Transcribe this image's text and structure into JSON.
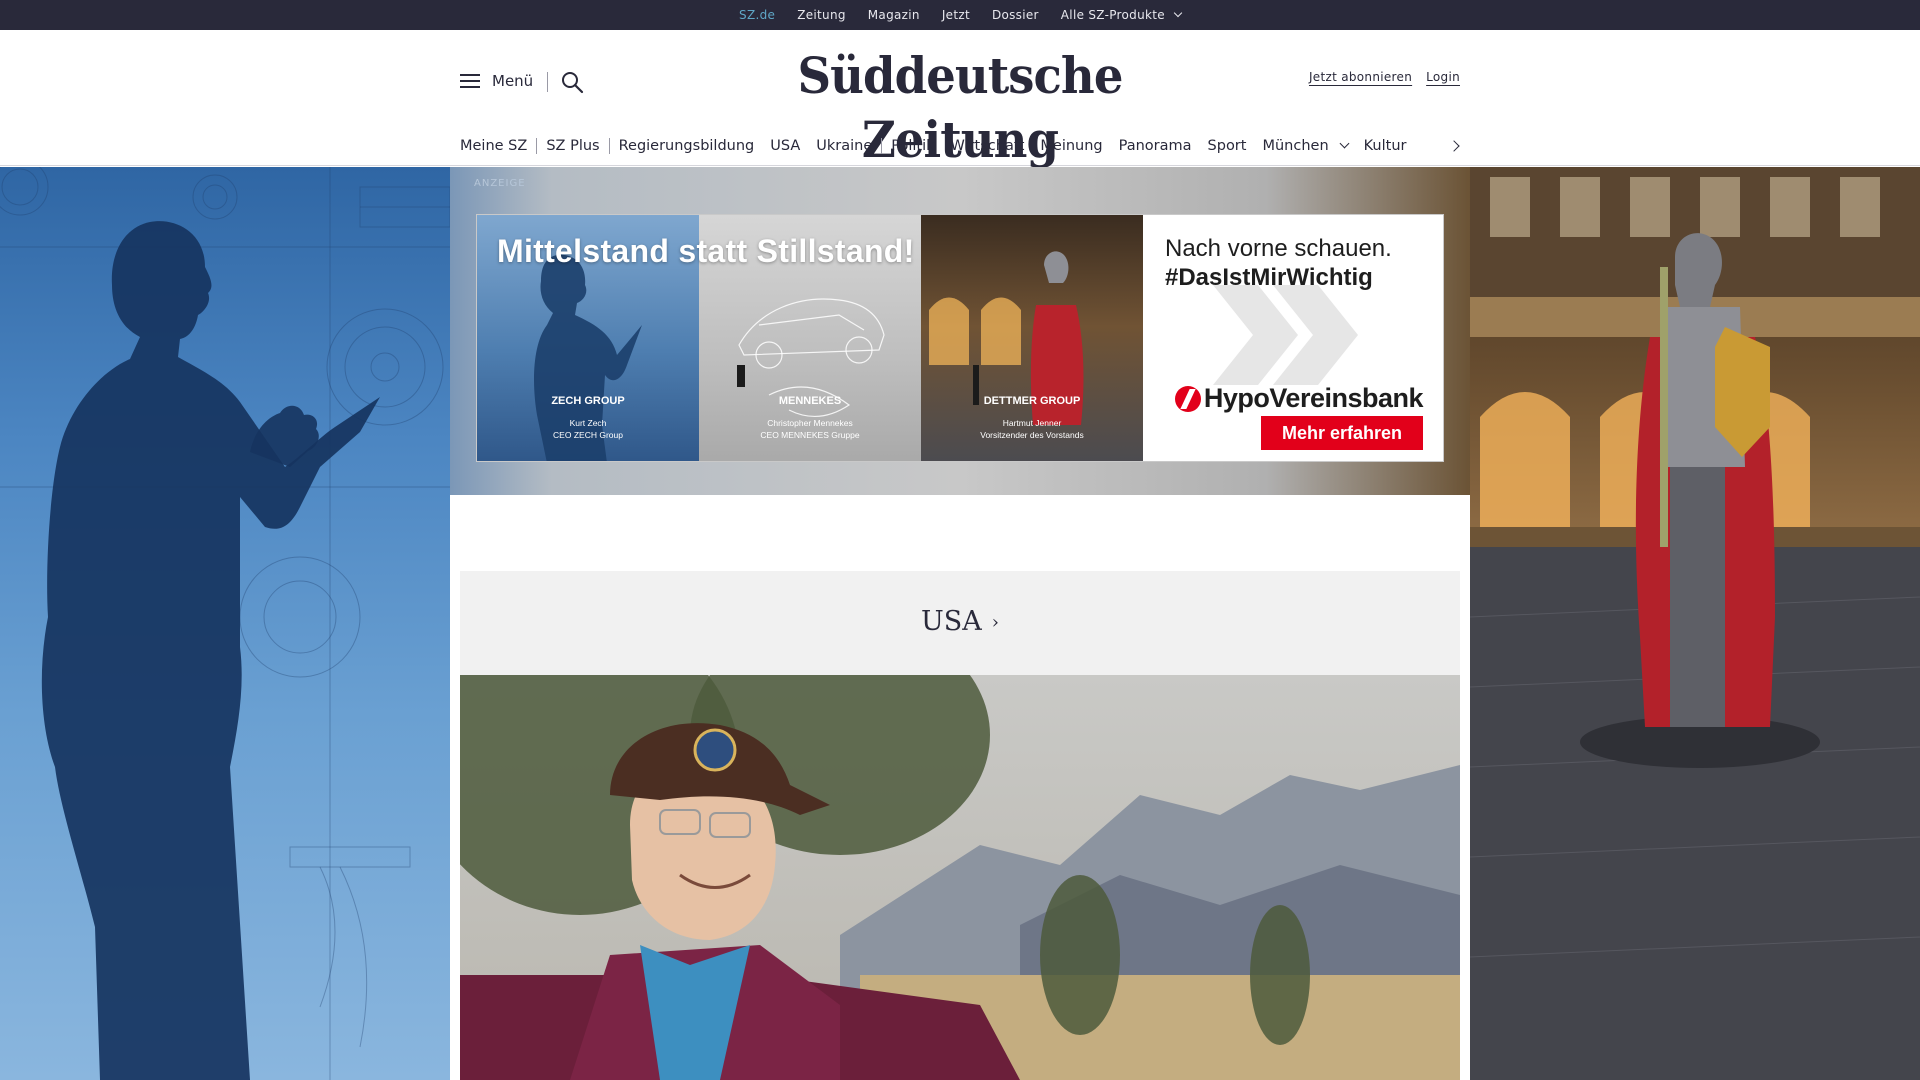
{
  "topbar": {
    "links": [
      "SZ.de",
      "Zeitung",
      "Magazin",
      "Jetzt",
      "Dossier",
      "Alle SZ-Produkte"
    ],
    "active": "SZ.de"
  },
  "header": {
    "menu_label": "Menü",
    "logo": "Süddeutsche Zeitung",
    "subscribe": "Jetzt abonnieren",
    "login": "Login"
  },
  "nav": {
    "items": [
      "Meine SZ",
      "SZ Plus",
      "Regierungsbildung",
      "USA",
      "Ukraine",
      "Politik",
      "Wirtschaft",
      "Meinung",
      "Panorama",
      "Sport",
      "München",
      "Kultur"
    ]
  },
  "ad": {
    "label": "ANZEIGE",
    "headline": "Mittelstand statt Stillstand!",
    "panels": [
      {
        "company": "ZECH GROUP",
        "person": "Kurt Zech",
        "role": "CEO ZECH Group"
      },
      {
        "company": "MENNEKES",
        "person": "Christopher Mennekes",
        "role": "CEO MENNEKES Gruppe"
      },
      {
        "company": "DETTMER GROUP",
        "person": "Hartmut Jenner",
        "role": "Vorsitzender des Vorstands"
      }
    ],
    "slogan": "Nach vorne schauen.",
    "hashtag": "#DasIstMirWichtig",
    "brand": "HypoVereinsbank",
    "cta": "Mehr erfahren",
    "brand_color": "#e2001a"
  },
  "section": {
    "title": "USA",
    "arrow": "›"
  },
  "colors": {
    "topbar_bg": "#29293a",
    "active_link": "#5fa6c6",
    "text": "#29293a",
    "section_bg": "#f1f1f1"
  },
  "icons": [
    "hamburger-icon",
    "search-icon",
    "chevron-down-icon",
    "chevron-right-icon"
  ]
}
